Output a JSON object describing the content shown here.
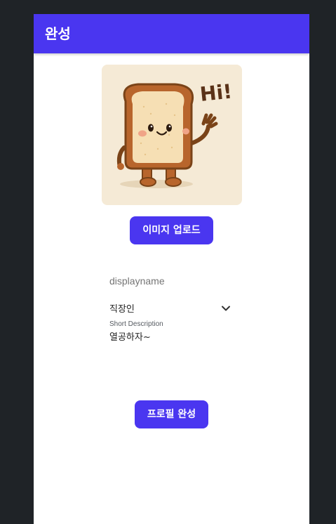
{
  "app_bar": {
    "title": "완성"
  },
  "profile_image": {
    "icon": "toast-character-illustration",
    "text": "Hi!"
  },
  "upload_button": {
    "label": "이미지 업로드"
  },
  "form": {
    "display_name": {
      "placeholder": "displayname",
      "value": ""
    },
    "occupation": {
      "selected": "직장인",
      "icon": "chevron-down-icon"
    },
    "short_description": {
      "label": "Short Description",
      "value": "열공하자~"
    }
  },
  "complete_button": {
    "label": "프로필 완성"
  },
  "colors": {
    "accent": "#4a36f0",
    "background": "#1f2327",
    "surface": "#ffffff"
  }
}
